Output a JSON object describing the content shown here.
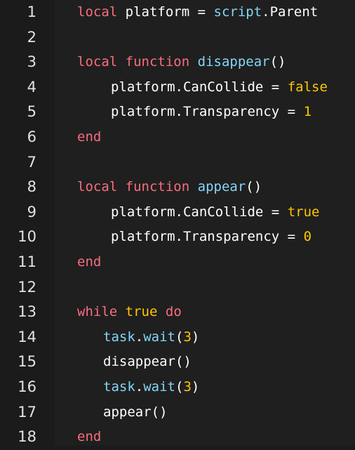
{
  "lines": [
    {
      "n": "1",
      "tokens": [
        [
          "kw",
          "local"
        ],
        [
          "id",
          " platform "
        ],
        [
          "op",
          "="
        ],
        [
          "id",
          " "
        ],
        [
          "fn",
          "script"
        ],
        [
          "id",
          ".Parent"
        ]
      ]
    },
    {
      "n": "2",
      "tokens": []
    },
    {
      "n": "3",
      "tokens": [
        [
          "kw",
          "local"
        ],
        [
          "id",
          " "
        ],
        [
          "kw",
          "function"
        ],
        [
          "id",
          " "
        ],
        [
          "fn",
          "disappear"
        ],
        [
          "id",
          "()"
        ]
      ]
    },
    {
      "n": "4",
      "tokens": [
        [
          "id",
          "platform.CanCollide "
        ],
        [
          "op",
          "="
        ],
        [
          "id",
          " "
        ],
        [
          "bool",
          "false"
        ]
      ]
    },
    {
      "n": "5",
      "tokens": [
        [
          "id",
          "platform.Transparency "
        ],
        [
          "op",
          "="
        ],
        [
          "id",
          " "
        ],
        [
          "num",
          "1"
        ]
      ]
    },
    {
      "n": "6",
      "tokens": [
        [
          "kw",
          "end"
        ]
      ]
    },
    {
      "n": "7",
      "tokens": []
    },
    {
      "n": "8",
      "tokens": [
        [
          "kw",
          "local"
        ],
        [
          "id",
          " "
        ],
        [
          "kw",
          "function"
        ],
        [
          "id",
          " "
        ],
        [
          "fn",
          "appear"
        ],
        [
          "id",
          "()"
        ]
      ]
    },
    {
      "n": "9",
      "tokens": [
        [
          "id",
          "platform.CanCollide "
        ],
        [
          "op",
          "="
        ],
        [
          "id",
          " "
        ],
        [
          "bool",
          "true"
        ]
      ]
    },
    {
      "n": "10",
      "tokens": [
        [
          "id",
          "platform.Transparency "
        ],
        [
          "op",
          "="
        ],
        [
          "id",
          " "
        ],
        [
          "num",
          "0"
        ]
      ]
    },
    {
      "n": "11",
      "tokens": [
        [
          "kw",
          "end"
        ]
      ]
    },
    {
      "n": "12",
      "tokens": []
    },
    {
      "n": "13",
      "tokens": [
        [
          "kw",
          "while"
        ],
        [
          "id",
          " "
        ],
        [
          "bool",
          "true"
        ],
        [
          "id",
          " "
        ],
        [
          "kw",
          "do"
        ]
      ]
    },
    {
      "n": "14",
      "tokens": [
        [
          "fn",
          "task"
        ],
        [
          "id",
          "."
        ],
        [
          "fn",
          "wait"
        ],
        [
          "id",
          "("
        ],
        [
          "num",
          "3"
        ],
        [
          "id",
          ")"
        ]
      ]
    },
    {
      "n": "15",
      "tokens": [
        [
          "id",
          "disappear()"
        ]
      ]
    },
    {
      "n": "16",
      "tokens": [
        [
          "fn",
          "task"
        ],
        [
          "id",
          "."
        ],
        [
          "fn",
          "wait"
        ],
        [
          "id",
          "("
        ],
        [
          "num",
          "3"
        ],
        [
          "id",
          ")"
        ]
      ]
    },
    {
      "n": "17",
      "tokens": [
        [
          "id",
          "appear()"
        ]
      ]
    },
    {
      "n": "18",
      "tokens": [
        [
          "kw",
          "end"
        ]
      ]
    }
  ],
  "colors": {
    "keyword": "#f86d7c",
    "identifier": "#ffffff",
    "builtin": "#84d6f7",
    "literal": "#ffc600",
    "line_number": "#e2e2e2",
    "background": "#1f1f1f",
    "gutter": "#1b1b1b"
  }
}
